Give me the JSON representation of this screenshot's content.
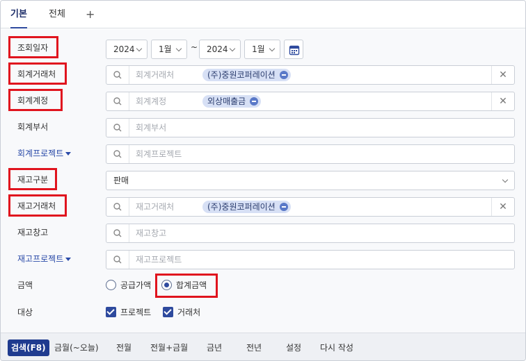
{
  "tabs": [
    {
      "label": "기본"
    },
    {
      "label": "전체"
    }
  ],
  "add_tab_symbol": "+",
  "period": {
    "label": "조회일자",
    "from_year": "2024",
    "from_month": "1월",
    "separator": "~",
    "to_year": "2024",
    "to_month": "1월"
  },
  "account_partner": {
    "label": "회계거래처",
    "placeholder": "회계거래처",
    "chip": "(주)중원코퍼레이션"
  },
  "account_code": {
    "label": "회계계정",
    "placeholder": "회계계정",
    "chip": "외상매출금"
  },
  "account_dept": {
    "label": "회계부서",
    "placeholder": "회계부서"
  },
  "account_project": {
    "label": "회계프로젝트",
    "placeholder": "회계프로젝트"
  },
  "inventory_type": {
    "label": "재고구분",
    "value": "판매"
  },
  "inventory_partner": {
    "label": "재고거래처",
    "placeholder": "재고거래처",
    "chip": "(주)중원코퍼레이션"
  },
  "warehouse": {
    "label": "재고창고",
    "placeholder": "재고창고"
  },
  "inventory_project": {
    "label": "재고프로젝트",
    "placeholder": "재고프로젝트"
  },
  "amount": {
    "label": "금액",
    "options": [
      "공급가액",
      "합계금액"
    ],
    "selected": "합계금액"
  },
  "target": {
    "label": "대상",
    "options": [
      {
        "label": "프로젝트",
        "checked": true
      },
      {
        "label": "거래처",
        "checked": true
      }
    ]
  },
  "bottom_buttons": [
    "검색(F8)",
    "금월(~오늘)",
    "전월",
    "전월+금월",
    "금년",
    "전년",
    "설정",
    "다시 작성"
  ],
  "colors": {
    "accent": "#2e4a9e",
    "highlight": "#e0141e",
    "chip_bg": "#d7e0f5"
  }
}
